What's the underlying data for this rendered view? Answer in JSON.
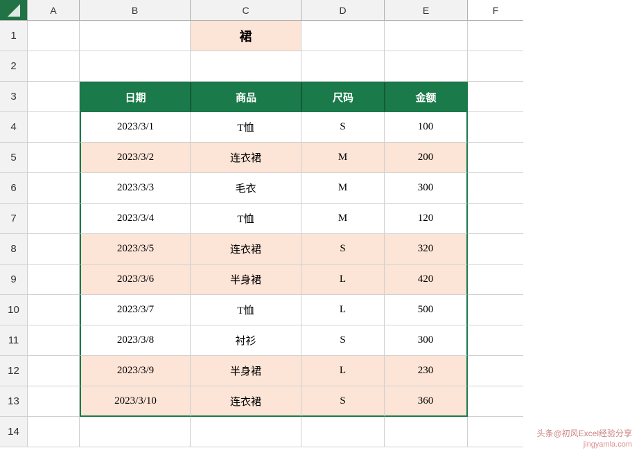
{
  "columns": [
    {
      "label": "A",
      "width": 75
    },
    {
      "label": "B",
      "width": 160
    },
    {
      "label": "C",
      "width": 160
    },
    {
      "label": "D",
      "width": 120
    },
    {
      "label": "E",
      "width": 120
    },
    {
      "label": "F",
      "width": 80
    }
  ],
  "rows": [
    {
      "num": "1",
      "cells": [
        {
          "col": "a",
          "value": "",
          "style": "normal"
        },
        {
          "col": "b",
          "value": "",
          "style": "normal"
        },
        {
          "col": "c",
          "value": "裙",
          "style": "title"
        },
        {
          "col": "d",
          "value": "",
          "style": "normal"
        },
        {
          "col": "e",
          "value": "",
          "style": "normal"
        },
        {
          "col": "f",
          "value": "",
          "style": "normal"
        }
      ]
    },
    {
      "num": "2",
      "cells": [
        {
          "col": "a",
          "value": "",
          "style": "normal"
        },
        {
          "col": "b",
          "value": "",
          "style": "normal"
        },
        {
          "col": "c",
          "value": "",
          "style": "normal"
        },
        {
          "col": "d",
          "value": "",
          "style": "normal"
        },
        {
          "col": "e",
          "value": "",
          "style": "normal"
        },
        {
          "col": "f",
          "value": "",
          "style": "normal"
        }
      ]
    },
    {
      "num": "3",
      "cells": [
        {
          "col": "a",
          "value": "",
          "style": "normal"
        },
        {
          "col": "b",
          "value": "日期",
          "style": "header"
        },
        {
          "col": "c",
          "value": "商品",
          "style": "header"
        },
        {
          "col": "d",
          "value": "尺码",
          "style": "header"
        },
        {
          "col": "e",
          "value": "金额",
          "style": "header"
        },
        {
          "col": "f",
          "value": "",
          "style": "normal"
        }
      ]
    },
    {
      "num": "4",
      "highlight": false,
      "cells": [
        {
          "col": "a",
          "value": "",
          "style": "normal"
        },
        {
          "col": "b",
          "value": "2023/3/1",
          "style": "normal"
        },
        {
          "col": "c",
          "value": "T恤",
          "style": "normal"
        },
        {
          "col": "d",
          "value": "S",
          "style": "normal"
        },
        {
          "col": "e",
          "value": "100",
          "style": "normal"
        },
        {
          "col": "f",
          "value": "",
          "style": "normal"
        }
      ]
    },
    {
      "num": "5",
      "highlight": true,
      "cells": [
        {
          "col": "a",
          "value": "",
          "style": "normal"
        },
        {
          "col": "b",
          "value": "2023/3/2",
          "style": "highlight"
        },
        {
          "col": "c",
          "value": "连衣裙",
          "style": "highlight"
        },
        {
          "col": "d",
          "value": "M",
          "style": "highlight"
        },
        {
          "col": "e",
          "value": "200",
          "style": "highlight"
        },
        {
          "col": "f",
          "value": "",
          "style": "normal"
        }
      ]
    },
    {
      "num": "6",
      "highlight": false,
      "cells": [
        {
          "col": "a",
          "value": "",
          "style": "normal"
        },
        {
          "col": "b",
          "value": "2023/3/3",
          "style": "normal"
        },
        {
          "col": "c",
          "value": "毛衣",
          "style": "normal"
        },
        {
          "col": "d",
          "value": "M",
          "style": "normal"
        },
        {
          "col": "e",
          "value": "300",
          "style": "normal"
        },
        {
          "col": "f",
          "value": "",
          "style": "normal"
        }
      ]
    },
    {
      "num": "7",
      "highlight": false,
      "cells": [
        {
          "col": "a",
          "value": "",
          "style": "normal"
        },
        {
          "col": "b",
          "value": "2023/3/4",
          "style": "normal"
        },
        {
          "col": "c",
          "value": "T恤",
          "style": "normal"
        },
        {
          "col": "d",
          "value": "M",
          "style": "normal"
        },
        {
          "col": "e",
          "value": "120",
          "style": "normal"
        },
        {
          "col": "f",
          "value": "",
          "style": "normal"
        }
      ]
    },
    {
      "num": "8",
      "highlight": true,
      "cells": [
        {
          "col": "a",
          "value": "",
          "style": "normal"
        },
        {
          "col": "b",
          "value": "2023/3/5",
          "style": "highlight"
        },
        {
          "col": "c",
          "value": "连衣裙",
          "style": "highlight"
        },
        {
          "col": "d",
          "value": "S",
          "style": "highlight"
        },
        {
          "col": "e",
          "value": "320",
          "style": "highlight"
        },
        {
          "col": "f",
          "value": "",
          "style": "normal"
        }
      ]
    },
    {
      "num": "9",
      "highlight": true,
      "cells": [
        {
          "col": "a",
          "value": "",
          "style": "normal"
        },
        {
          "col": "b",
          "value": "2023/3/6",
          "style": "highlight"
        },
        {
          "col": "c",
          "value": "半身裙",
          "style": "highlight"
        },
        {
          "col": "d",
          "value": "L",
          "style": "highlight"
        },
        {
          "col": "e",
          "value": "420",
          "style": "highlight"
        },
        {
          "col": "f",
          "value": "",
          "style": "normal"
        }
      ]
    },
    {
      "num": "10",
      "highlight": false,
      "cells": [
        {
          "col": "a",
          "value": "",
          "style": "normal"
        },
        {
          "col": "b",
          "value": "2023/3/7",
          "style": "normal"
        },
        {
          "col": "c",
          "value": "T恤",
          "style": "normal"
        },
        {
          "col": "d",
          "value": "L",
          "style": "normal"
        },
        {
          "col": "e",
          "value": "500",
          "style": "normal"
        },
        {
          "col": "f",
          "value": "",
          "style": "normal"
        }
      ]
    },
    {
      "num": "11",
      "highlight": false,
      "cells": [
        {
          "col": "a",
          "value": "",
          "style": "normal"
        },
        {
          "col": "b",
          "value": "2023/3/8",
          "style": "normal"
        },
        {
          "col": "c",
          "value": "衬衫",
          "style": "normal"
        },
        {
          "col": "d",
          "value": "S",
          "style": "normal"
        },
        {
          "col": "e",
          "value": "300",
          "style": "normal"
        },
        {
          "col": "f",
          "value": "",
          "style": "normal"
        }
      ]
    },
    {
      "num": "12",
      "highlight": true,
      "cells": [
        {
          "col": "a",
          "value": "",
          "style": "normal"
        },
        {
          "col": "b",
          "value": "2023/3/9",
          "style": "highlight"
        },
        {
          "col": "c",
          "value": "半身裙",
          "style": "highlight"
        },
        {
          "col": "d",
          "value": "L",
          "style": "highlight"
        },
        {
          "col": "e",
          "value": "230",
          "style": "highlight"
        },
        {
          "col": "f",
          "value": "",
          "style": "normal"
        }
      ]
    },
    {
      "num": "13",
      "highlight": true,
      "cells": [
        {
          "col": "a",
          "value": "",
          "style": "normal"
        },
        {
          "col": "b",
          "value": "2023/3/10",
          "style": "highlight"
        },
        {
          "col": "c",
          "value": "连衣裙",
          "style": "highlight"
        },
        {
          "col": "d",
          "value": "S",
          "style": "highlight"
        },
        {
          "col": "e",
          "value": "360",
          "style": "highlight"
        },
        {
          "col": "f",
          "value": "",
          "style": "normal"
        }
      ]
    },
    {
      "num": "14",
      "cells": [
        {
          "col": "a",
          "value": "",
          "style": "normal"
        },
        {
          "col": "b",
          "value": "",
          "style": "normal"
        },
        {
          "col": "c",
          "value": "",
          "style": "normal"
        },
        {
          "col": "d",
          "value": "",
          "style": "normal"
        },
        {
          "col": "e",
          "value": "",
          "style": "normal"
        },
        {
          "col": "f",
          "value": "",
          "style": "normal"
        }
      ]
    }
  ],
  "watermark": "头条@初风Excel经验分享\njingyamla.com",
  "title": "裙"
}
